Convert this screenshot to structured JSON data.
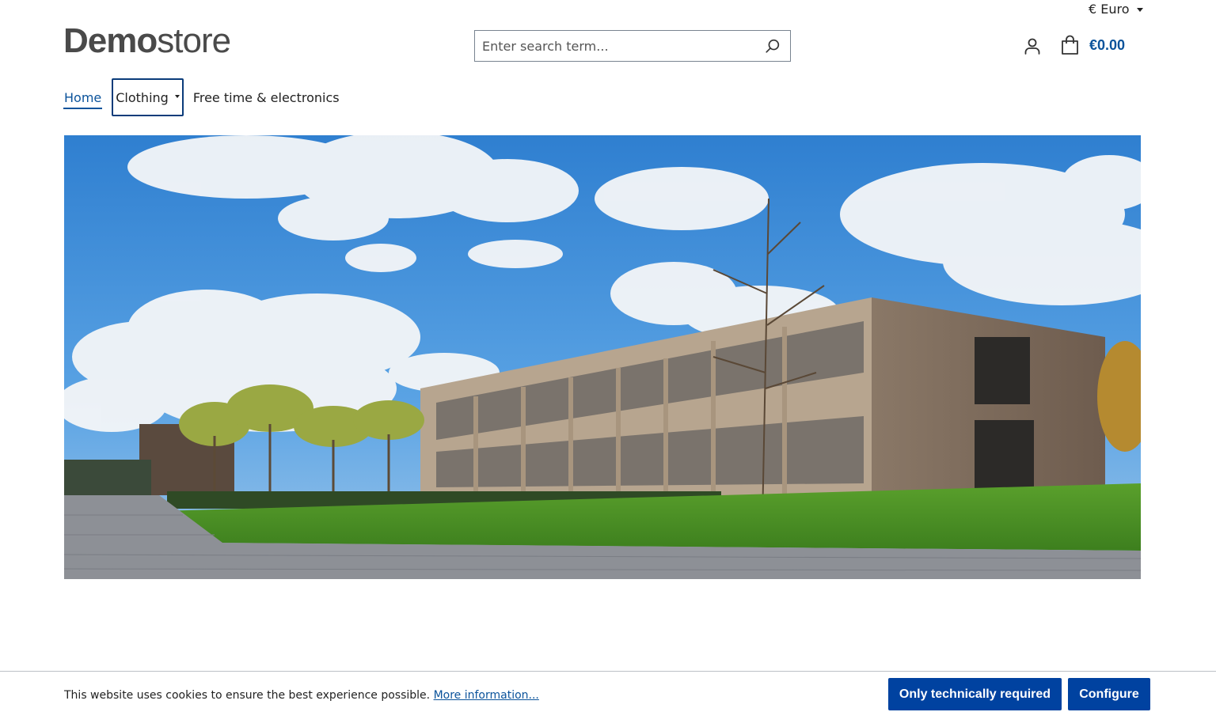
{
  "header": {
    "currency_label": "€ Euro",
    "logo_bold": "Demo",
    "logo_light": "store",
    "search_placeholder": "Enter search term...",
    "cart_total": "€0.00"
  },
  "nav": {
    "items": [
      {
        "label": "Home"
      },
      {
        "label": "Clothing"
      },
      {
        "label": "Free time & electronics"
      }
    ]
  },
  "colors": {
    "brand_blue": "#0b539b",
    "button_blue": "#0042a0"
  },
  "cookie": {
    "message": "This website uses cookies to ensure the best experience possible.",
    "link_text": "More information...",
    "required_button": "Only technically required",
    "configure_button": "Configure"
  },
  "icons": {
    "search": "search-icon",
    "account": "user-icon",
    "cart": "shopping-bag-icon",
    "currency_dropdown": "caret-down-icon"
  }
}
